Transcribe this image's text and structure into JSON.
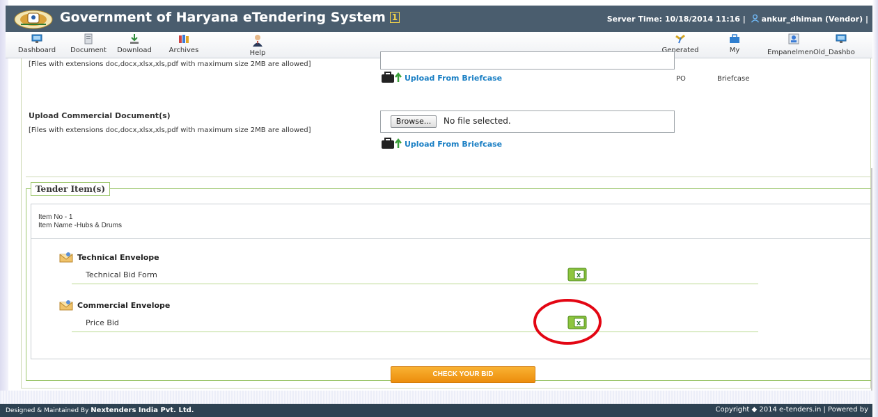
{
  "header": {
    "title": "Government of Haryana eTendering System",
    "title_badge": "1",
    "server_time": "Server Time: 10/18/2014 11:16",
    "separator": "|",
    "user": "ankur_dhiman (Vendor)",
    "trailing_separator": "|"
  },
  "toolbar": {
    "left_items": [
      {
        "label": "Dashboard",
        "icon": "monitor-icon"
      },
      {
        "label": "Document",
        "icon": "document-icon"
      },
      {
        "label": "Download",
        "icon": "download-icon"
      },
      {
        "label": "Archives",
        "icon": "archives-icon"
      },
      {
        "label": "Help",
        "icon": "help-icon"
      }
    ],
    "right_items": [
      {
        "label": "Generated",
        "icon": "generated-icon"
      },
      {
        "label": "My",
        "icon": "briefcase-icon"
      },
      {
        "label": "EmpanelmenOld_Dashbo",
        "icon": "empanelment-icon"
      }
    ]
  },
  "technical_upload": {
    "hint": "[Files with extensions doc,docx,xlsx,xls,pdf with maximum size 2MB are allowed]",
    "briefcase_link": "Upload From Briefcase",
    "side_labels": [
      "PO",
      "Briefcase"
    ]
  },
  "commercial_upload": {
    "label": "Upload Commercial Document(s)",
    "hint": "[Files with extensions doc,docx,xlsx,xls,pdf with maximum size 2MB are allowed]",
    "browse_label": "Browse...",
    "file_status": "No file selected.",
    "briefcase_link": "Upload From Briefcase"
  },
  "tender_items": {
    "legend": "Tender Item(s)",
    "item_no": "Item No - 1",
    "item_name": "Item Name -Hubs & Drums",
    "envelopes": [
      {
        "title": "Technical Envelope",
        "form": "Technical Bid Form"
      },
      {
        "title": "Commercial Envelope",
        "form": "Price Bid"
      }
    ]
  },
  "check_button": "CHECK YOUR BID",
  "footer": {
    "left_prefix": "Designed & Maintained By",
    "company": "Nextenders India Pvt. Ltd.",
    "right": "Copyright ◆ 2014 e-tenders.in | Powered by"
  },
  "colors": {
    "header_bg": "#4a5d6e",
    "footer_bg": "#2e4252",
    "link": "#1a7fc4",
    "accent_orange": "#f39c1f",
    "fieldset_border": "#9cc66c",
    "annotation_red": "#e30613"
  }
}
